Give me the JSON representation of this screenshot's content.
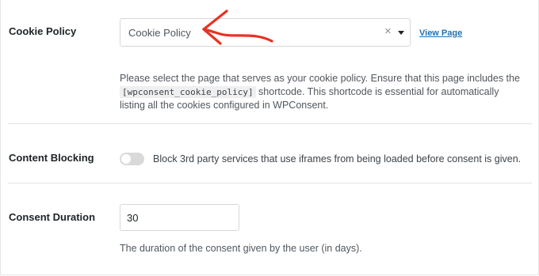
{
  "cookie_policy": {
    "label": "Cookie Policy",
    "selected_value": "Cookie Policy",
    "clear_symbol": "×",
    "view_link": "View Page",
    "description_before": "Please select the page that serves as your cookie policy. Ensure that this page includes the ",
    "shortcode": "[wpconsent_cookie_policy]",
    "description_after": " shortcode. This shortcode is essential for automatically listing all the cookies configured in WPConsent.",
    "arrow_color": "#e63323"
  },
  "content_blocking": {
    "label": "Content Blocking",
    "toggle_state": "off",
    "toggle_text": "Block 3rd party services that use iframes from being loaded before consent is given."
  },
  "consent_duration": {
    "label": "Consent Duration",
    "value": "30",
    "description": "The duration of the consent given by the user (in days)."
  },
  "colors": {
    "link": "#2271b1",
    "toggle_off": "#d9d9d9"
  }
}
